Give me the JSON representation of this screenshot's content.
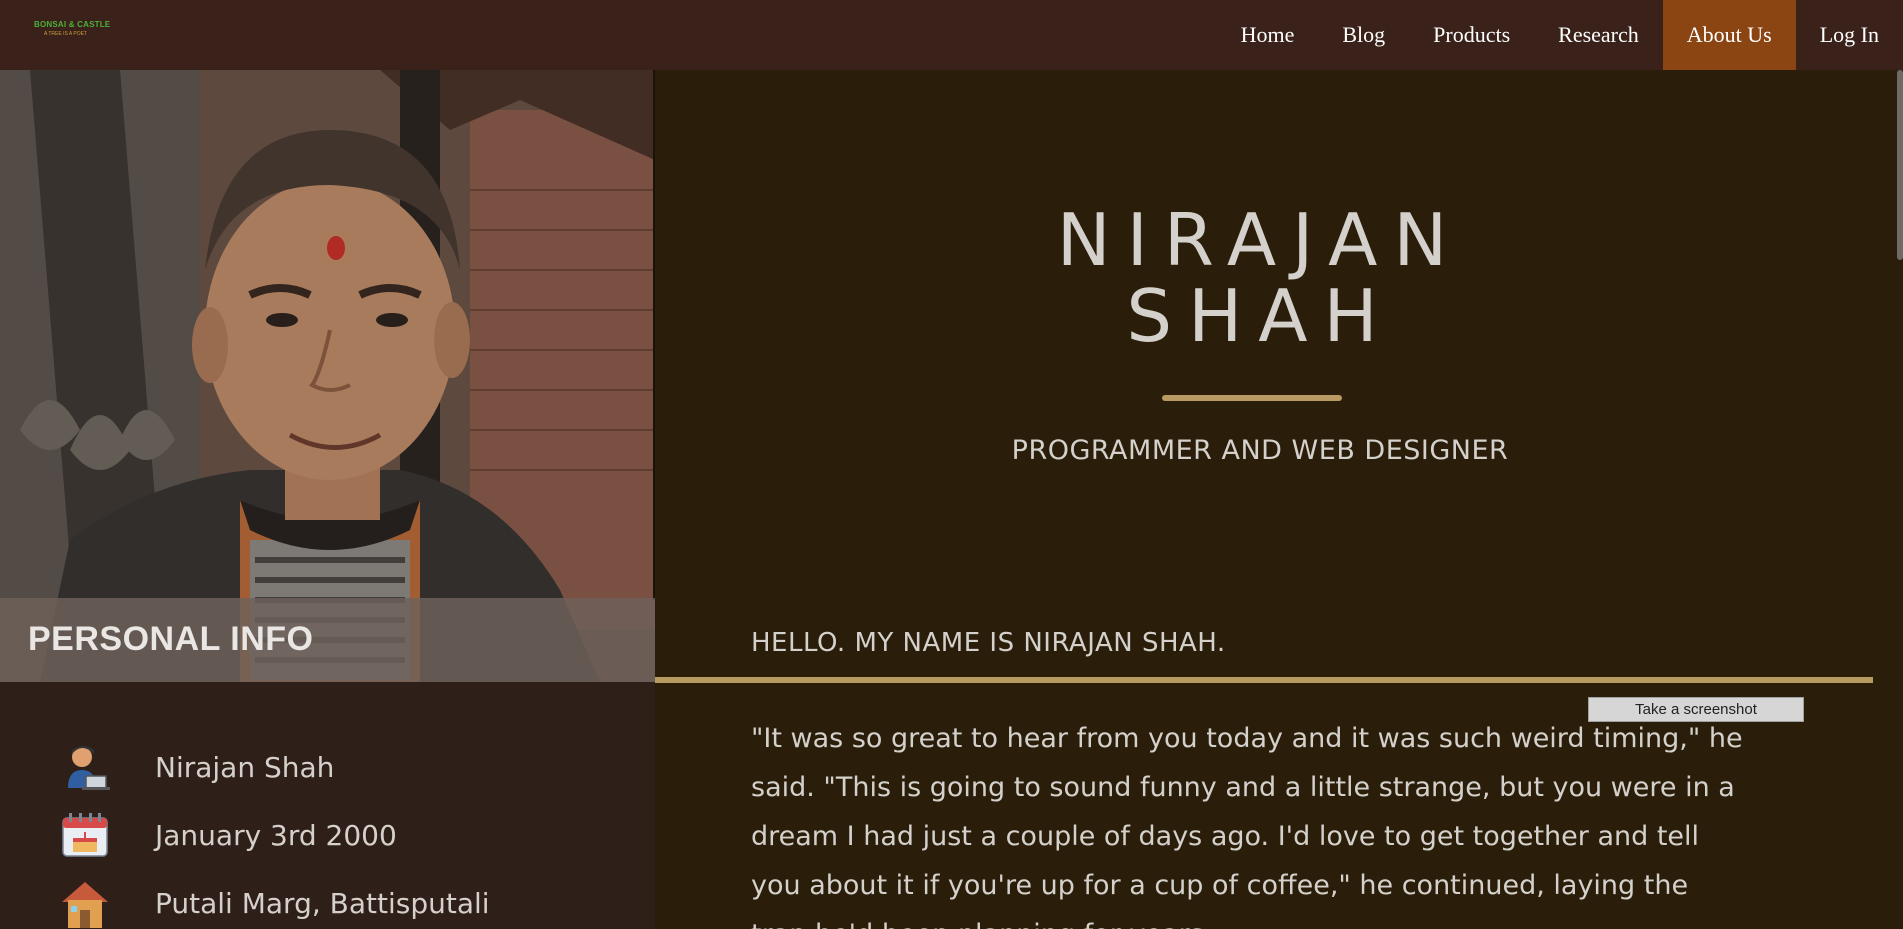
{
  "logo": {
    "line1": "BONSAI & CASTLE",
    "line2": "A TREE IS A POET"
  },
  "nav": {
    "items": [
      {
        "label": "Home",
        "active": false
      },
      {
        "label": "Blog",
        "active": false
      },
      {
        "label": "Products",
        "active": false
      },
      {
        "label": "Research",
        "active": false
      },
      {
        "label": "About Us",
        "active": true
      },
      {
        "label": "Log In",
        "active": false
      }
    ]
  },
  "personal_info": {
    "title": "PERSONAL INFO",
    "items": [
      {
        "icon": "programmer-icon",
        "text": "Nirajan Shah"
      },
      {
        "icon": "birthday-calendar-icon",
        "text": "January 3rd 2000"
      },
      {
        "icon": "house-icon",
        "text": "Putali Marg, Battisputali"
      }
    ]
  },
  "profile": {
    "name_line1": "NIRAJAN",
    "name_line2": "SHAH",
    "role": "PROGRAMMER AND WEB DESIGNER",
    "hello": "HELLO. MY NAME IS NIRAJAN SHAH.",
    "quote": "\"It was so great to hear from you today and it was such weird timing,\" he said. \"This is going to sound funny and a little strange, but you were in a dream I had just a couple of days ago. I'd love to get together and tell you about it if you're up for a cup of coffee,\" he continued, laying the trap he'd been planning for years."
  },
  "screenshot_button": {
    "label": "Take a screenshot"
  },
  "colors": {
    "navbar": "#3a2119",
    "active_nav": "#8b4513",
    "accent_gold": "#b89a62",
    "main_bg": "#2a1e0a"
  }
}
